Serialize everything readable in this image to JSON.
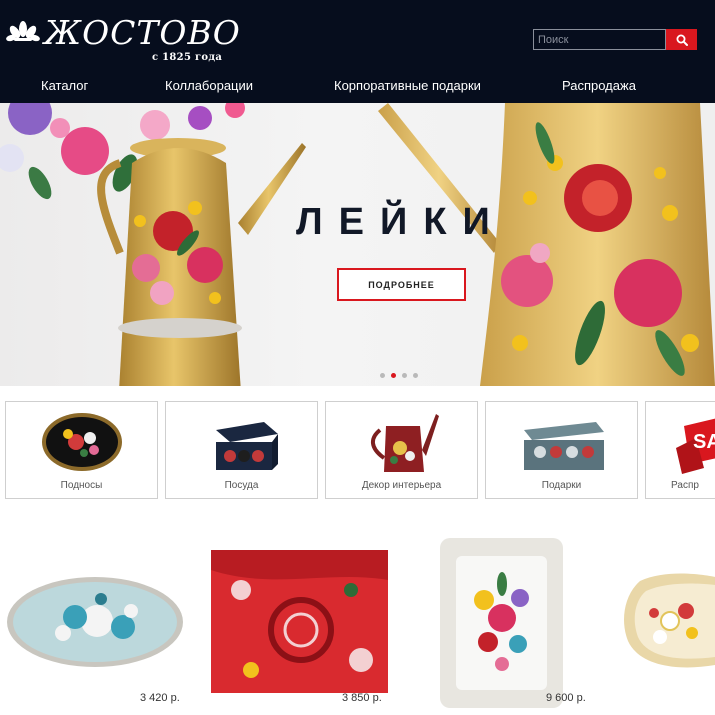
{
  "brand": {
    "name": "ЖОСТОВО",
    "since": "с 1825 года"
  },
  "search": {
    "placeholder": "Поиск"
  },
  "nav": {
    "items": [
      "Каталог",
      "Коллаборации",
      "Корпоративные подарки",
      "Распродажа"
    ]
  },
  "hero": {
    "title": "ЛЕЙКИ",
    "button_label": "ПОДРОБНЕЕ",
    "slide_count": 4,
    "active_slide": 2
  },
  "categories": [
    "Подносы",
    "Посуда",
    "Декор интерьера",
    "Подарки",
    "Распр"
  ],
  "sale_sign_text": "SA",
  "products": [
    {
      "price": "3 420 р."
    },
    {
      "price": "3 850 р."
    },
    {
      "price": "9 600 р."
    }
  ],
  "colors": {
    "header_bg": "#060d1d",
    "accent": "#d9171e",
    "nav_text": "#ffffff"
  },
  "icons": {
    "logo": "flower-logo-icon",
    "search": "search-icon"
  }
}
